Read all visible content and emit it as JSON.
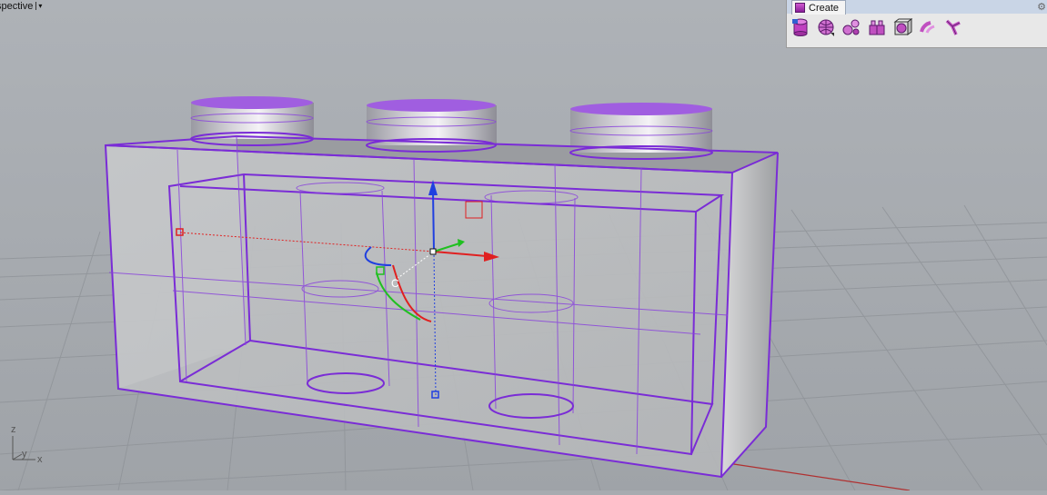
{
  "viewport": {
    "name": "spective",
    "dropdown_glyph": "▾"
  },
  "toolbar": {
    "tab_label": "Create",
    "tab_icon": "create-tab-icon",
    "settings_glyph": "⚙",
    "buttons": [
      {
        "icon": "cylinder-icon"
      },
      {
        "icon": "box-mesh-icon"
      },
      {
        "icon": "curve-tool-icon"
      },
      {
        "icon": "array-icon"
      },
      {
        "icon": "boolean-box-icon"
      },
      {
        "icon": "pipe-icon"
      },
      {
        "icon": "branch-icon"
      }
    ]
  },
  "axes": {
    "z": "z",
    "y": "y",
    "x": "x"
  },
  "colors": {
    "background": "#a7abb0",
    "wireframe": "#7a2cd6",
    "grid": "#8f9398",
    "x_axis": "#e02020",
    "y_axis": "#20c020",
    "z_axis": "#2040e0",
    "toolbar_tab": "#c9d5e6"
  }
}
